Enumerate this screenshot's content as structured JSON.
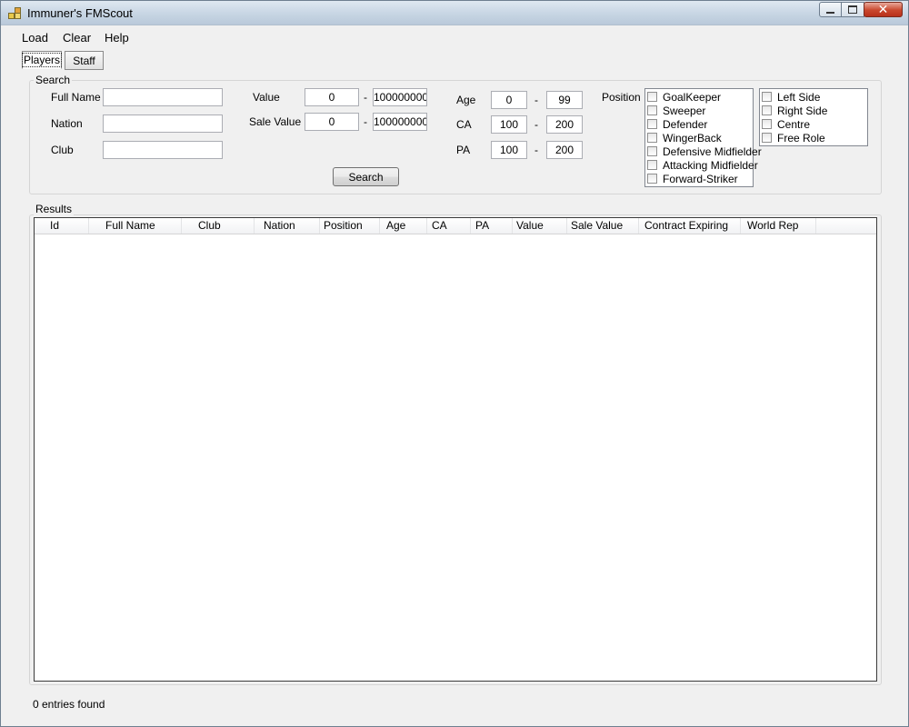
{
  "window": {
    "title": "Immuner's FMScout"
  },
  "menu": {
    "load": "Load",
    "clear": "Clear",
    "help": "Help"
  },
  "tabs": {
    "players": "Players",
    "staff": "Staff"
  },
  "search": {
    "legend": "Search",
    "full_name_label": "Full Name",
    "nation_label": "Nation",
    "club_label": "Club",
    "full_name_value": "",
    "nation_value": "",
    "club_value": "",
    "value_label": "Value",
    "value_min": "0",
    "value_max": "100000000",
    "sale_value_label": "Sale Value",
    "sale_value_min": "0",
    "sale_value_max": "100000000",
    "range_dash": "-",
    "age_label": "Age",
    "age_min": "0",
    "age_max": "99",
    "ca_label": "CA",
    "ca_min": "100",
    "ca_max": "200",
    "pa_label": "PA",
    "pa_min": "100",
    "pa_max": "200",
    "position_label": "Position",
    "positions": [
      {
        "label": "GoalKeeper",
        "checked": false
      },
      {
        "label": "Sweeper",
        "checked": false
      },
      {
        "label": "Defender",
        "checked": false
      },
      {
        "label": "WingerBack",
        "checked": false
      },
      {
        "label": "Defensive Midfielder",
        "checked": false
      },
      {
        "label": "Attacking Midfielder",
        "checked": false
      },
      {
        "label": "Forward-Striker",
        "checked": false
      }
    ],
    "sides": [
      {
        "label": "Left Side",
        "checked": false
      },
      {
        "label": "Right Side",
        "checked": false
      },
      {
        "label": "Centre",
        "checked": false
      },
      {
        "label": "Free Role",
        "checked": false
      }
    ],
    "search_button": "Search"
  },
  "results": {
    "legend": "Results",
    "columns": [
      "Id",
      "Full Name",
      "Club",
      "Nation",
      "Position",
      "Age",
      "CA",
      "PA",
      "Value",
      "Sale Value",
      "Contract Expiring",
      "World Rep"
    ],
    "rows": []
  },
  "status": {
    "text": "0 entries found"
  }
}
